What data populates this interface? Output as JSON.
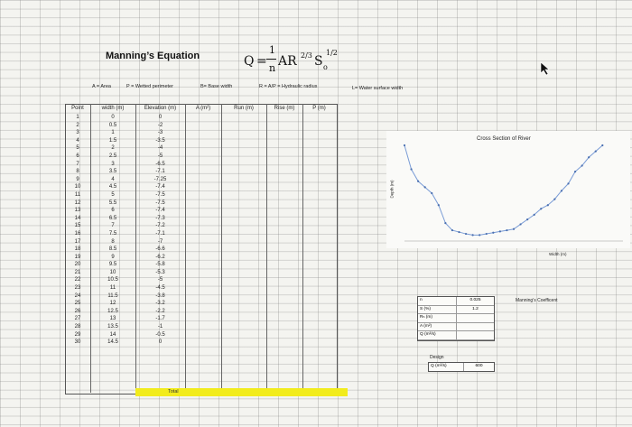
{
  "title": "Manning’s Equation",
  "equation": {
    "lhs": "Q",
    "eq": "=",
    "numerator": "1",
    "denominator": "n",
    "body": "AR",
    "r_exponent": "2/3",
    "s": "S",
    "s_sub": "o",
    "s_exponent": "1/2"
  },
  "definitions": {
    "area": "A = Area",
    "perimeter": "P = Wetted perimeter",
    "base_width": "B= Base width",
    "hydraulic_radius": "R = A/P = Hydraulic radius",
    "water_surface_width": "L= Water surface width"
  },
  "table": {
    "headers": [
      "Point",
      "width (m)",
      "Elevation (m)",
      "A (m²)",
      "Run (m)",
      "Rise (m)",
      "P (m)"
    ],
    "points": [
      "1",
      "2",
      "3",
      "4",
      "5",
      "6",
      "7",
      "8",
      "9",
      "10",
      "11",
      "12",
      "13",
      "14",
      "15",
      "16",
      "17",
      "18",
      "19",
      "20",
      "21",
      "22",
      "23",
      "24",
      "25",
      "26",
      "27",
      "28",
      "29",
      "30"
    ],
    "widths": [
      "0",
      "0.5",
      "1",
      "1.5",
      "2",
      "2.5",
      "3",
      "3.5",
      "4",
      "4.5",
      "5",
      "5.5",
      "6",
      "6.5",
      "7",
      "7.5",
      "8",
      "8.5",
      "9",
      "9.5",
      "10",
      "10.5",
      "11",
      "11.5",
      "12",
      "12.5",
      "13",
      "13.5",
      "14",
      "14.5"
    ],
    "elevations": [
      "0",
      "-2",
      "-3",
      "-3.5",
      "-4",
      "-5",
      "-6.5",
      "-7.1",
      "-7.25",
      "-7.4",
      "-7.5",
      "-7.5",
      "-7.4",
      "-7.3",
      "-7.2",
      "-7.1",
      "-7",
      "-6.6",
      "-6.2",
      "-5.8",
      "-5.3",
      "-5",
      "-4.5",
      "-3.8",
      "-3.2",
      "-2.2",
      "-1.7",
      "-1",
      "-0.5",
      "0"
    ],
    "total_label": "Total"
  },
  "chart_data": {
    "type": "scatter",
    "title": "Cross Section of River",
    "xlabel": "Width (m)",
    "ylabel": "Depth (m)",
    "x": [
      0,
      0.5,
      1,
      1.5,
      2,
      2.5,
      3,
      3.5,
      4,
      4.5,
      5,
      5.5,
      6,
      6.5,
      7,
      7.5,
      8,
      8.5,
      9,
      9.5,
      10,
      10.5,
      11,
      11.5,
      12,
      12.5,
      13,
      13.5,
      14,
      14.5
    ],
    "y": [
      0,
      -2,
      -3,
      -3.5,
      -4,
      -5,
      -6.5,
      -7.1,
      -7.25,
      -7.4,
      -7.5,
      -7.5,
      -7.4,
      -7.3,
      -7.2,
      -7.1,
      -7,
      -6.6,
      -6.2,
      -5.8,
      -5.3,
      -5,
      -4.5,
      -3.8,
      -3.2,
      -2.2,
      -1.7,
      -1,
      -0.5,
      0
    ],
    "xlim": [
      0,
      16
    ],
    "ylim": [
      -8,
      0
    ],
    "grid": false,
    "line_color": "#7a9cd6"
  },
  "params": {
    "rows": [
      {
        "label": "n",
        "value": "0.025"
      },
      {
        "label": "S (%)",
        "value": "1.2"
      },
      {
        "label": "Rₕ (m)",
        "value": ""
      },
      {
        "label": "A (m²)",
        "value": ""
      },
      {
        "label": "Q (m³/s)",
        "value": ""
      }
    ],
    "note": "Manning’s Coefficent"
  },
  "design": {
    "label": "Design",
    "q_label": "Q (m³/s)",
    "value": "600"
  }
}
